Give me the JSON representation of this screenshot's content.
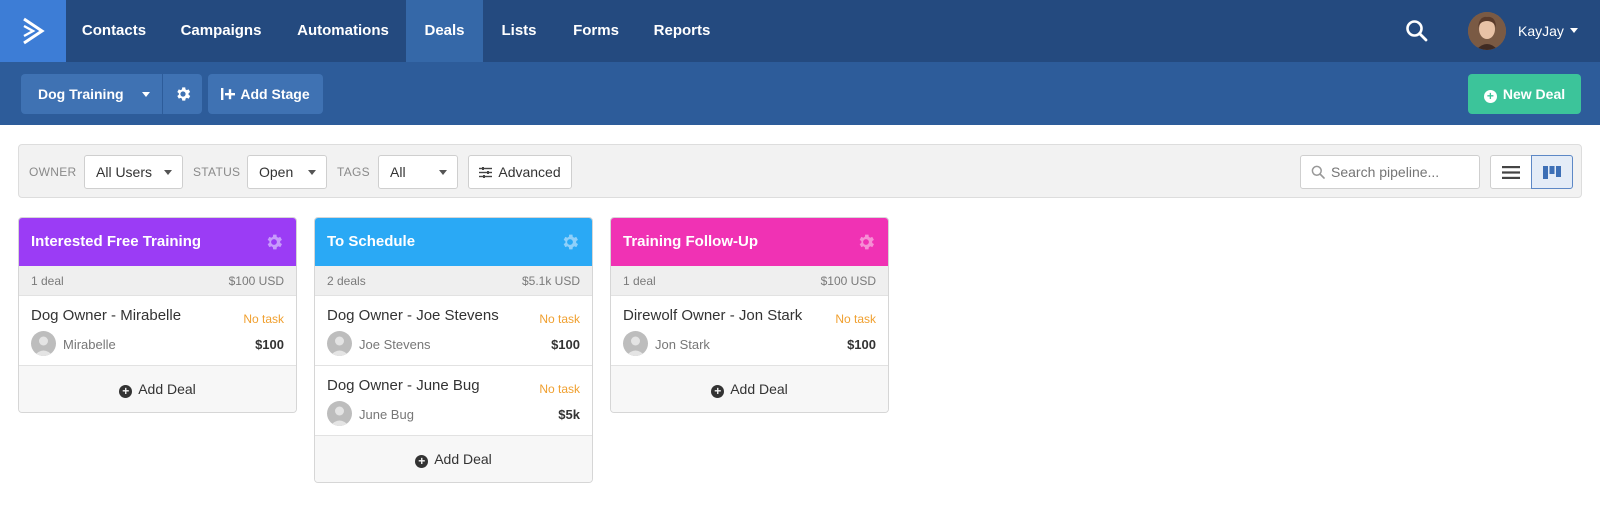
{
  "nav": {
    "items": [
      {
        "label": "Contacts"
      },
      {
        "label": "Campaigns"
      },
      {
        "label": "Automations"
      },
      {
        "label": "Deals"
      },
      {
        "label": "Lists"
      },
      {
        "label": "Forms"
      },
      {
        "label": "Reports"
      }
    ],
    "active": "Deals",
    "user": {
      "name": "KayJay"
    }
  },
  "toolbar": {
    "pipeline": "Dog Training",
    "add_stage": "Add Stage",
    "new_deal": "New Deal"
  },
  "filters": {
    "owner": {
      "label": "OWNER",
      "value": "All Users"
    },
    "status": {
      "label": "STATUS",
      "value": "Open"
    },
    "tags": {
      "label": "TAGS",
      "value": "All"
    },
    "advanced": "Advanced",
    "search_placeholder": "Search pipeline..."
  },
  "colors": {
    "nav_bg": "#244a7f",
    "subbar_bg": "#2d5c9a",
    "new_deal": "#3cc49a",
    "stage_1": "#9b3cf5",
    "stage_2": "#2aa9f5",
    "stage_3": "#f032b4",
    "no_task": "#f0a030"
  },
  "stages": [
    {
      "name": "Interested Free Training",
      "count": "1 deal",
      "total": "$100 USD",
      "deals": [
        {
          "title": "Dog Owner - Mirabelle",
          "task": "No task",
          "contact": "Mirabelle",
          "value": "$100"
        }
      ],
      "add_label": "Add Deal"
    },
    {
      "name": "To Schedule",
      "count": "2 deals",
      "total": "$5.1k USD",
      "deals": [
        {
          "title": "Dog Owner - Joe Stevens",
          "task": "No task",
          "contact": "Joe Stevens",
          "value": "$100"
        },
        {
          "title": "Dog Owner - June Bug",
          "task": "No task",
          "contact": "June Bug",
          "value": "$5k"
        }
      ],
      "add_label": "Add Deal"
    },
    {
      "name": "Training Follow-Up",
      "count": "1 deal",
      "total": "$100 USD",
      "deals": [
        {
          "title": "Direwolf Owner - Jon Stark",
          "task": "No task",
          "contact": "Jon Stark",
          "value": "$100"
        }
      ],
      "add_label": "Add Deal"
    }
  ]
}
